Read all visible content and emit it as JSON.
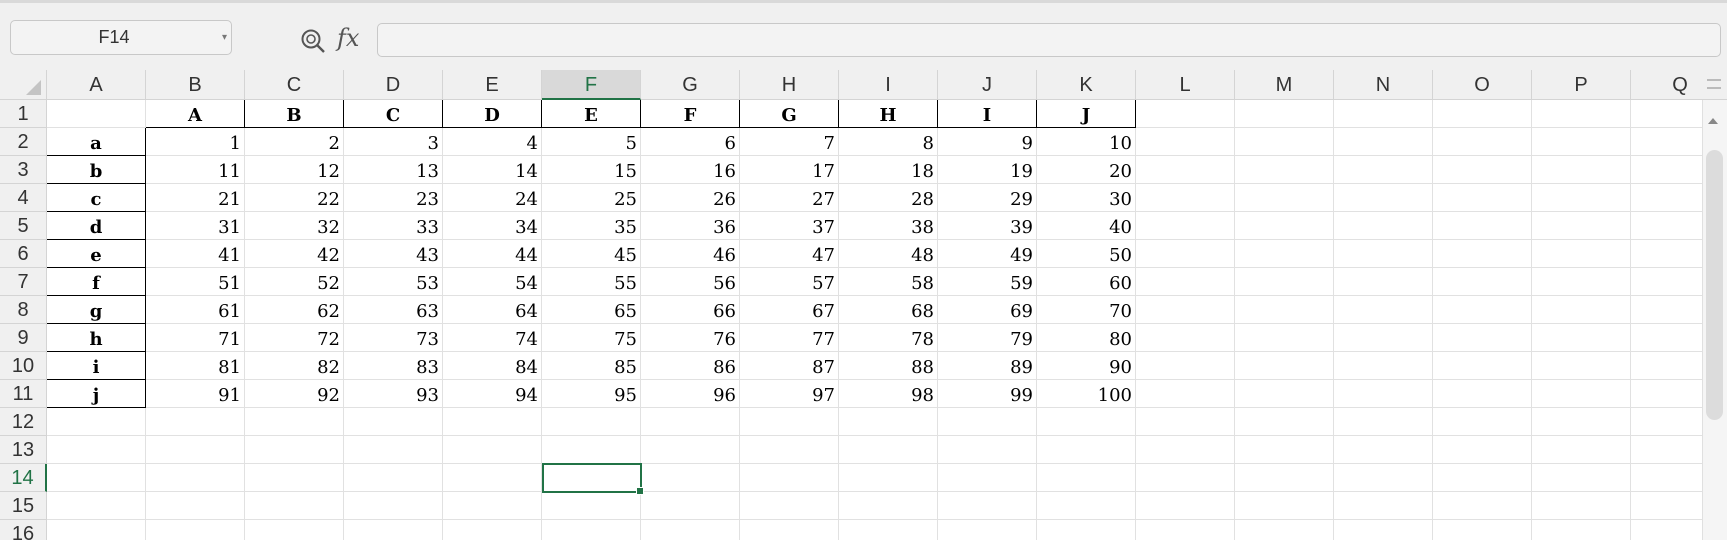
{
  "formula_bar": {
    "name_box": "F14",
    "fx_label": "fx",
    "formula_value": ""
  },
  "columns": [
    "A",
    "B",
    "C",
    "D",
    "E",
    "F",
    "G",
    "H",
    "I",
    "J",
    "K",
    "L",
    "M",
    "N",
    "O",
    "P",
    "Q"
  ],
  "rows": [
    "1",
    "2",
    "3",
    "4",
    "5",
    "6",
    "7",
    "8",
    "9",
    "10",
    "11",
    "12",
    "13",
    "14",
    "15",
    "16"
  ],
  "active_cell": {
    "column": "F",
    "row": "14"
  },
  "table": {
    "header_row": [
      "A",
      "B",
      "C",
      "D",
      "E",
      "F",
      "G",
      "H",
      "I",
      "J"
    ],
    "row_labels": [
      "a",
      "b",
      "c",
      "d",
      "e",
      "f",
      "g",
      "h",
      "i",
      "j"
    ],
    "values": [
      [
        1,
        2,
        3,
        4,
        5,
        6,
        7,
        8,
        9,
        10
      ],
      [
        11,
        12,
        13,
        14,
        15,
        16,
        17,
        18,
        19,
        20
      ],
      [
        21,
        22,
        23,
        24,
        25,
        26,
        27,
        28,
        29,
        30
      ],
      [
        31,
        32,
        33,
        34,
        35,
        36,
        37,
        38,
        39,
        40
      ],
      [
        41,
        42,
        43,
        44,
        45,
        46,
        47,
        48,
        49,
        50
      ],
      [
        51,
        52,
        53,
        54,
        55,
        56,
        57,
        58,
        59,
        60
      ],
      [
        61,
        62,
        63,
        64,
        65,
        66,
        67,
        68,
        69,
        70
      ],
      [
        71,
        72,
        73,
        74,
        75,
        76,
        77,
        78,
        79,
        80
      ],
      [
        81,
        82,
        83,
        84,
        85,
        86,
        87,
        88,
        89,
        90
      ],
      [
        91,
        92,
        93,
        94,
        95,
        96,
        97,
        98,
        99,
        100
      ]
    ]
  },
  "icons": {
    "zoom": "zoom-formula-icon",
    "namebox_dropdown": "chevron-down-icon",
    "select_all": "select-all-icon",
    "scroll_up": "scroll-up-icon"
  },
  "colors": {
    "accent": "#217346",
    "header_bg": "#f0f0f0",
    "gridline": "#e1e1e1"
  }
}
